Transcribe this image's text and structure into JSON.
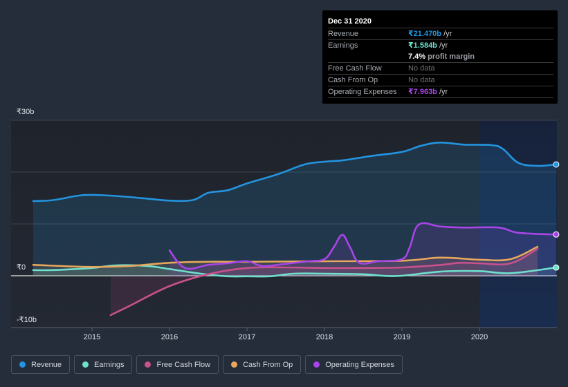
{
  "chart_data": {
    "type": "line",
    "title": "",
    "xlabel": "",
    "ylabel": "",
    "currency_symbol": "₹",
    "x_range": [
      2014.0,
      2021.0
    ],
    "ylim": [
      -10,
      30
    ],
    "y_ticks": [
      {
        "value": 30,
        "label": "₹30b"
      },
      {
        "value": 0,
        "label": "₹0"
      },
      {
        "value": -10,
        "label": "-₹10b"
      }
    ],
    "x_ticks": [
      {
        "value": 2015,
        "label": "2015"
      },
      {
        "value": 2016,
        "label": "2016"
      },
      {
        "value": 2017,
        "label": "2017"
      },
      {
        "value": 2018,
        "label": "2018"
      },
      {
        "value": 2019,
        "label": "2019"
      },
      {
        "value": 2020,
        "label": "2020"
      }
    ],
    "gridlines": [
      30,
      20,
      10,
      0,
      -10
    ],
    "highlight_range": [
      2020.0,
      2021.0
    ],
    "legend_position": "bottom-left",
    "series": [
      {
        "name": "Revenue",
        "key": "revenue",
        "color": "#2394df",
        "fill": true,
        "end_marker": true,
        "points": [
          [
            2014.24,
            14.4
          ],
          [
            2014.5,
            14.6
          ],
          [
            2014.8,
            15.4
          ],
          [
            2015.0,
            15.6
          ],
          [
            2015.3,
            15.4
          ],
          [
            2015.7,
            14.9
          ],
          [
            2016.0,
            14.5
          ],
          [
            2016.3,
            14.6
          ],
          [
            2016.5,
            16.0
          ],
          [
            2016.75,
            16.5
          ],
          [
            2017.0,
            17.8
          ],
          [
            2017.4,
            19.6
          ],
          [
            2017.75,
            21.5
          ],
          [
            2018.0,
            22.0
          ],
          [
            2018.25,
            22.3
          ],
          [
            2018.6,
            23.1
          ],
          [
            2019.0,
            23.9
          ],
          [
            2019.25,
            25.1
          ],
          [
            2019.5,
            25.7
          ],
          [
            2019.8,
            25.3
          ],
          [
            2020.15,
            25.2
          ],
          [
            2020.3,
            24.5
          ],
          [
            2020.5,
            21.8
          ],
          [
            2020.75,
            21.2
          ],
          [
            2020.99,
            21.47
          ]
        ]
      },
      {
        "name": "Earnings",
        "key": "earnings",
        "color": "#6ee0cd",
        "fill": true,
        "end_marker": true,
        "points": [
          [
            2014.24,
            1.1
          ],
          [
            2014.5,
            1.1
          ],
          [
            2015.0,
            1.5
          ],
          [
            2015.3,
            2.0
          ],
          [
            2015.7,
            1.9
          ],
          [
            2016.0,
            1.3
          ],
          [
            2016.4,
            0.4
          ],
          [
            2016.75,
            -0.1
          ],
          [
            2017.0,
            -0.1
          ],
          [
            2017.3,
            -0.1
          ],
          [
            2017.6,
            0.4
          ],
          [
            2018.0,
            0.4
          ],
          [
            2018.5,
            0.3
          ],
          [
            2018.75,
            0.0
          ],
          [
            2019.0,
            0.0
          ],
          [
            2019.5,
            0.8
          ],
          [
            2020.0,
            0.9
          ],
          [
            2020.4,
            0.5
          ],
          [
            2020.99,
            1.584
          ]
        ]
      },
      {
        "name": "Free Cash Flow",
        "key": "free_cash_flow",
        "color": "#c9518c",
        "fill": true,
        "end_marker": false,
        "points": [
          [
            2015.24,
            -7.6
          ],
          [
            2015.5,
            -5.7
          ],
          [
            2016.0,
            -2.0
          ],
          [
            2016.5,
            0.3
          ],
          [
            2017.0,
            1.5
          ],
          [
            2017.5,
            1.6
          ],
          [
            2018.0,
            1.5
          ],
          [
            2018.5,
            1.5
          ],
          [
            2019.0,
            1.6
          ],
          [
            2019.5,
            2.1
          ],
          [
            2019.75,
            2.5
          ],
          [
            2020.0,
            2.4
          ],
          [
            2020.4,
            2.4
          ],
          [
            2020.75,
            5.2
          ]
        ]
      },
      {
        "name": "Cash From Op",
        "key": "cash_from_op",
        "color": "#e8a75c",
        "fill": true,
        "end_marker": false,
        "points": [
          [
            2014.24,
            2.1
          ],
          [
            2015.0,
            1.7
          ],
          [
            2015.5,
            1.9
          ],
          [
            2016.0,
            2.5
          ],
          [
            2016.5,
            2.7
          ],
          [
            2017.0,
            2.7
          ],
          [
            2018.0,
            2.8
          ],
          [
            2019.0,
            2.9
          ],
          [
            2019.5,
            3.5
          ],
          [
            2020.0,
            3.1
          ],
          [
            2020.4,
            3.2
          ],
          [
            2020.75,
            5.6
          ]
        ]
      },
      {
        "name": "Operating Expenses",
        "key": "operating_expenses",
        "color": "#a845e6",
        "fill": true,
        "end_marker": true,
        "points": [
          [
            2016.0,
            4.9
          ],
          [
            2016.2,
            1.5
          ],
          [
            2016.5,
            2.1
          ],
          [
            2016.75,
            2.4
          ],
          [
            2017.0,
            2.8
          ],
          [
            2017.2,
            1.9
          ],
          [
            2017.5,
            2.3
          ],
          [
            2017.8,
            2.8
          ],
          [
            2018.0,
            3.2
          ],
          [
            2018.12,
            5.5
          ],
          [
            2018.23,
            7.9
          ],
          [
            2018.33,
            5.5
          ],
          [
            2018.45,
            2.5
          ],
          [
            2018.7,
            2.8
          ],
          [
            2019.0,
            3.2
          ],
          [
            2019.1,
            5.5
          ],
          [
            2019.22,
            9.9
          ],
          [
            2019.5,
            9.5
          ],
          [
            2019.8,
            9.3
          ],
          [
            2020.25,
            9.3
          ],
          [
            2020.5,
            8.3
          ],
          [
            2020.99,
            7.963
          ]
        ]
      }
    ]
  },
  "tooltip": {
    "date": "Dec 31 2020",
    "rows": [
      {
        "label": "Revenue",
        "value": "₹21.470b",
        "suffix": " /yr",
        "color": "#2394df"
      },
      {
        "label": "Earnings",
        "value": "₹1.584b",
        "suffix": " /yr",
        "color": "#6ee0cd"
      },
      {
        "label": "",
        "value": "7.4%",
        "suffix": " profit margin",
        "color": "#ffffff"
      },
      {
        "label": "Free Cash Flow",
        "value": "No data",
        "suffix": "",
        "color": ""
      },
      {
        "label": "Cash From Op",
        "value": "No data",
        "suffix": "",
        "color": ""
      },
      {
        "label": "Operating Expenses",
        "value": "₹7.963b",
        "suffix": " /yr",
        "color": "#a845e6"
      }
    ]
  },
  "legend": [
    {
      "label": "Revenue",
      "color": "#2394df"
    },
    {
      "label": "Earnings",
      "color": "#6ee0cd"
    },
    {
      "label": "Free Cash Flow",
      "color": "#c9518c"
    },
    {
      "label": "Cash From Op",
      "color": "#e8a75c"
    },
    {
      "label": "Operating Expenses",
      "color": "#a845e6"
    }
  ]
}
